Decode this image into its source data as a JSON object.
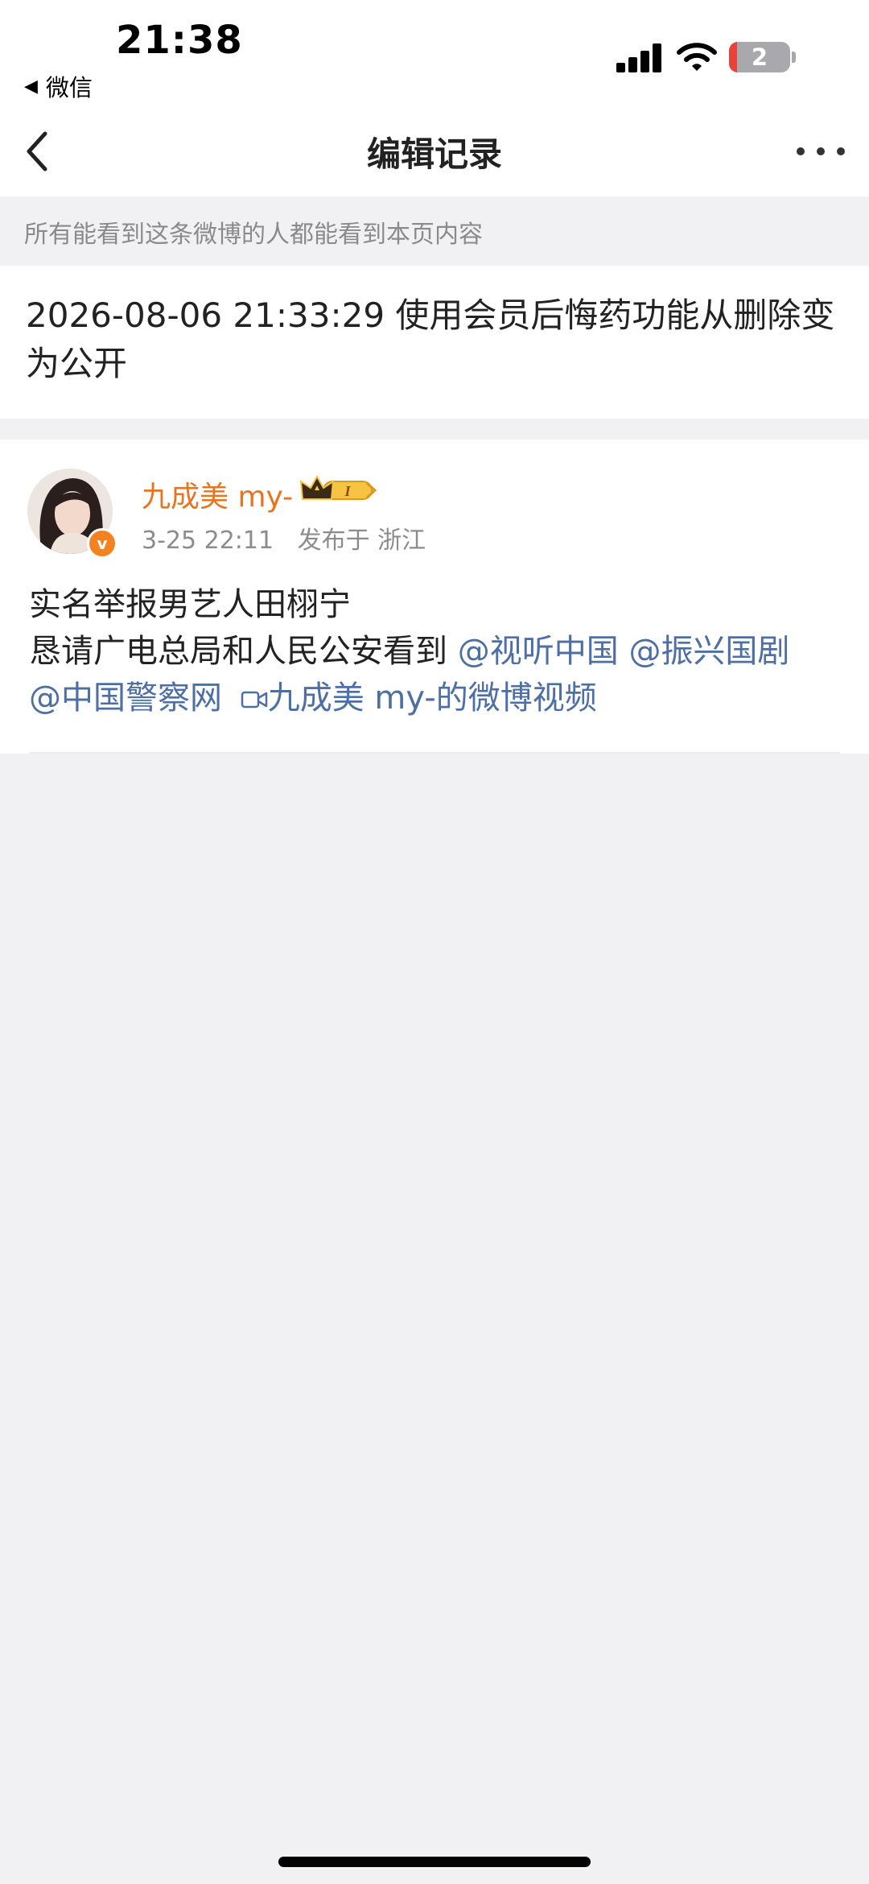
{
  "status_bar": {
    "time": "21:38",
    "back_app": "微信",
    "battery_level": "2"
  },
  "nav": {
    "title": "编辑记录"
  },
  "notice": {
    "text": "所有能看到这条微博的人都能看到本页内容"
  },
  "record": {
    "text": "2026-08-06 21:33:29 使用会员后悔药功能从删除变为公开"
  },
  "post": {
    "username": "九成美 my-",
    "time": "3-25 22:11",
    "location": "发布于 浙江",
    "line1": "实名举报男艺人田栩宁",
    "line2_text": "恳请广电总局和人民公安看到",
    "mentions": [
      "@视听中国",
      "@振兴国剧",
      "@中国警察网"
    ],
    "video_link": "九成美 my-的微博视频",
    "accent_color": "#e8741e",
    "link_color": "#4e6fa6"
  }
}
